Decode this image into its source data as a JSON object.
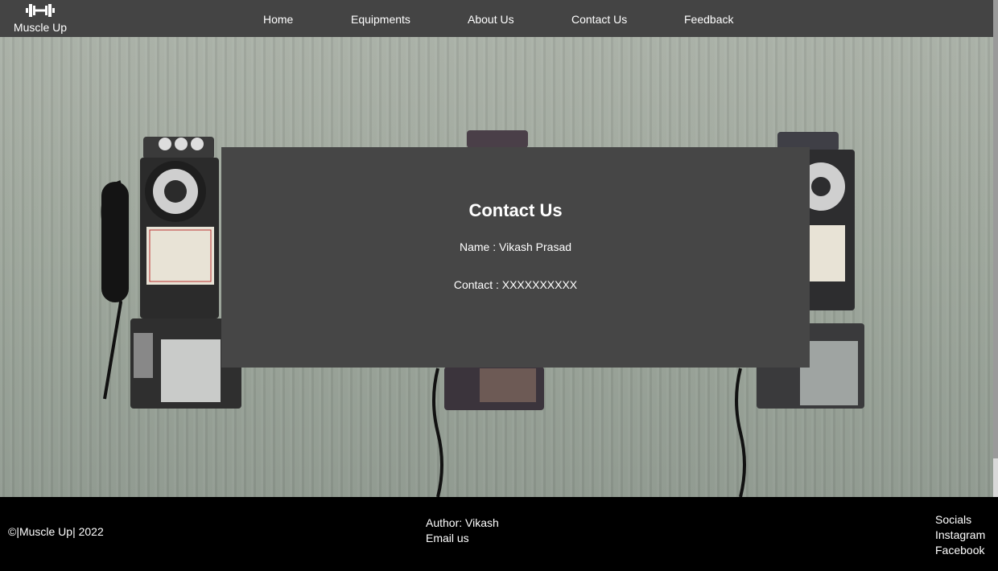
{
  "brand": {
    "name": "Muscle Up",
    "icon": "dumbbell-icon"
  },
  "nav": {
    "items": [
      {
        "label": "Home"
      },
      {
        "label": "Equipments"
      },
      {
        "label": "About Us"
      },
      {
        "label": "Contact Us"
      },
      {
        "label": "Feedback"
      }
    ]
  },
  "card": {
    "title": "Contact Us",
    "name_line": "Name : Vikash Prasad",
    "contact_line": "Contact : XXXXXXXXXX"
  },
  "footer": {
    "copyright": "©|Muscle Up| 2022",
    "author": "Author: Vikash",
    "email": "Email us",
    "socials_heading": "Socials",
    "instagram": "Instagram",
    "facebook": "Facebook"
  },
  "colors": {
    "navbar": "#444444",
    "card": "#464646",
    "footer": "#000000",
    "text": "#ffffff"
  }
}
